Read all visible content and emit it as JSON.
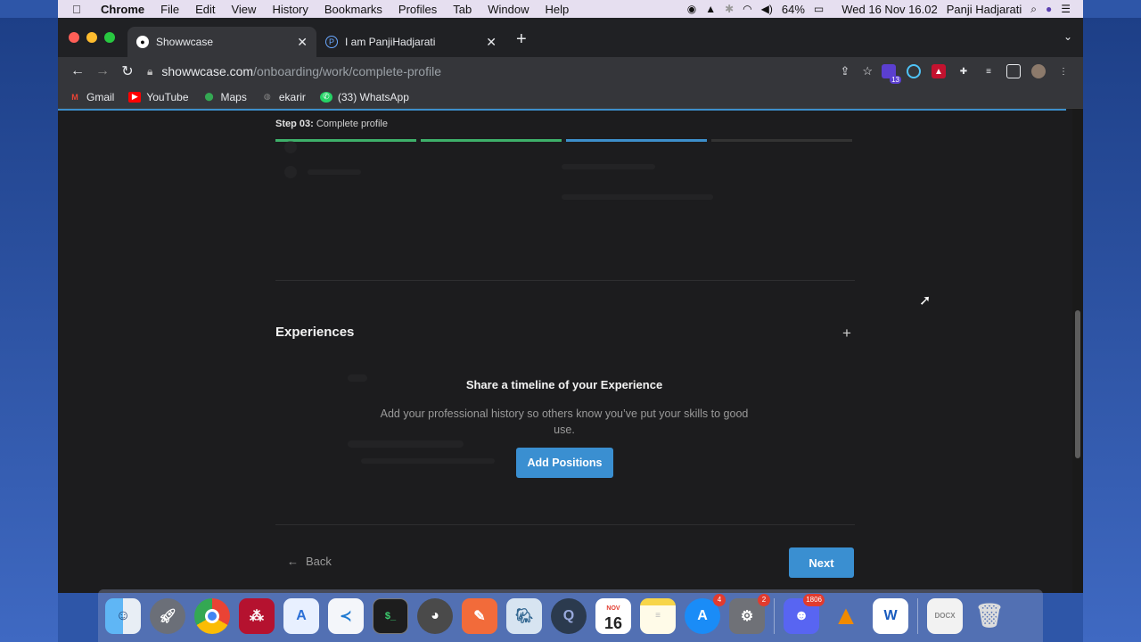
{
  "menubar": {
    "app_name": "Chrome",
    "items": [
      "File",
      "Edit",
      "View",
      "History",
      "Bookmarks",
      "Profiles",
      "Tab",
      "Window",
      "Help"
    ],
    "battery": "64%",
    "datetime": "Wed 16 Nov  16.02",
    "user": "Panji Hadjarati"
  },
  "tabs": [
    {
      "title": "Showwcase",
      "active": true
    },
    {
      "title": "I am PanjiHadjarati",
      "active": false
    }
  ],
  "address": {
    "host": "showwcase.com",
    "path": "/onboarding/work/complete-profile"
  },
  "extensions": {
    "badge_count": "13"
  },
  "bookmarks": [
    {
      "label": "Gmail",
      "icon": "gmail-icon"
    },
    {
      "label": "YouTube",
      "icon": "youtube-icon"
    },
    {
      "label": "Maps",
      "icon": "maps-icon"
    },
    {
      "label": "ekarir",
      "icon": "globe-icon"
    },
    {
      "label": "(33) WhatsApp",
      "icon": "whatsapp-icon"
    }
  ],
  "page": {
    "step_prefix": "Step 03:",
    "step_label": "Complete profile",
    "steps_progress": [
      1,
      1,
      0.5,
      0
    ],
    "section_title": "Experiences",
    "empty_title": "Share a timeline of your Experience",
    "empty_desc": "Add your professional history so others know you’ve put your skills to good use.",
    "add_button": "Add Positions",
    "back_button": "Back",
    "next_button": "Next"
  },
  "dock": {
    "apps": [
      {
        "name": "Finder",
        "badge": ""
      },
      {
        "name": "Launchpad",
        "badge": ""
      },
      {
        "name": "Chrome",
        "badge": ""
      },
      {
        "name": "Mendeley",
        "badge": ""
      },
      {
        "name": "Xcode Instruments",
        "badge": ""
      },
      {
        "name": "VS Code",
        "badge": ""
      },
      {
        "name": "Terminal",
        "badge": ""
      },
      {
        "name": "TablePlus",
        "badge": ""
      },
      {
        "name": "Postman",
        "badge": ""
      },
      {
        "name": "pgAdmin",
        "badge": ""
      },
      {
        "name": "QuickTime",
        "badge": ""
      },
      {
        "name": "Calendar",
        "badge": ""
      },
      {
        "name": "Notes",
        "badge": ""
      },
      {
        "name": "App Store",
        "badge": "4"
      },
      {
        "name": "System Preferences",
        "badge": "2"
      },
      {
        "name": "Discord",
        "badge": "1806"
      },
      {
        "name": "VLC",
        "badge": ""
      },
      {
        "name": "Word",
        "badge": ""
      },
      {
        "name": "Document",
        "badge": ""
      },
      {
        "name": "Trash",
        "badge": ""
      }
    ],
    "calendar_month": "NOV",
    "calendar_day": "16"
  },
  "colors": {
    "accent": "#3a8fd1",
    "step_done": "#3eb06a",
    "step_current": "#3d8fcb",
    "page_bg": "#1c1c1e"
  }
}
